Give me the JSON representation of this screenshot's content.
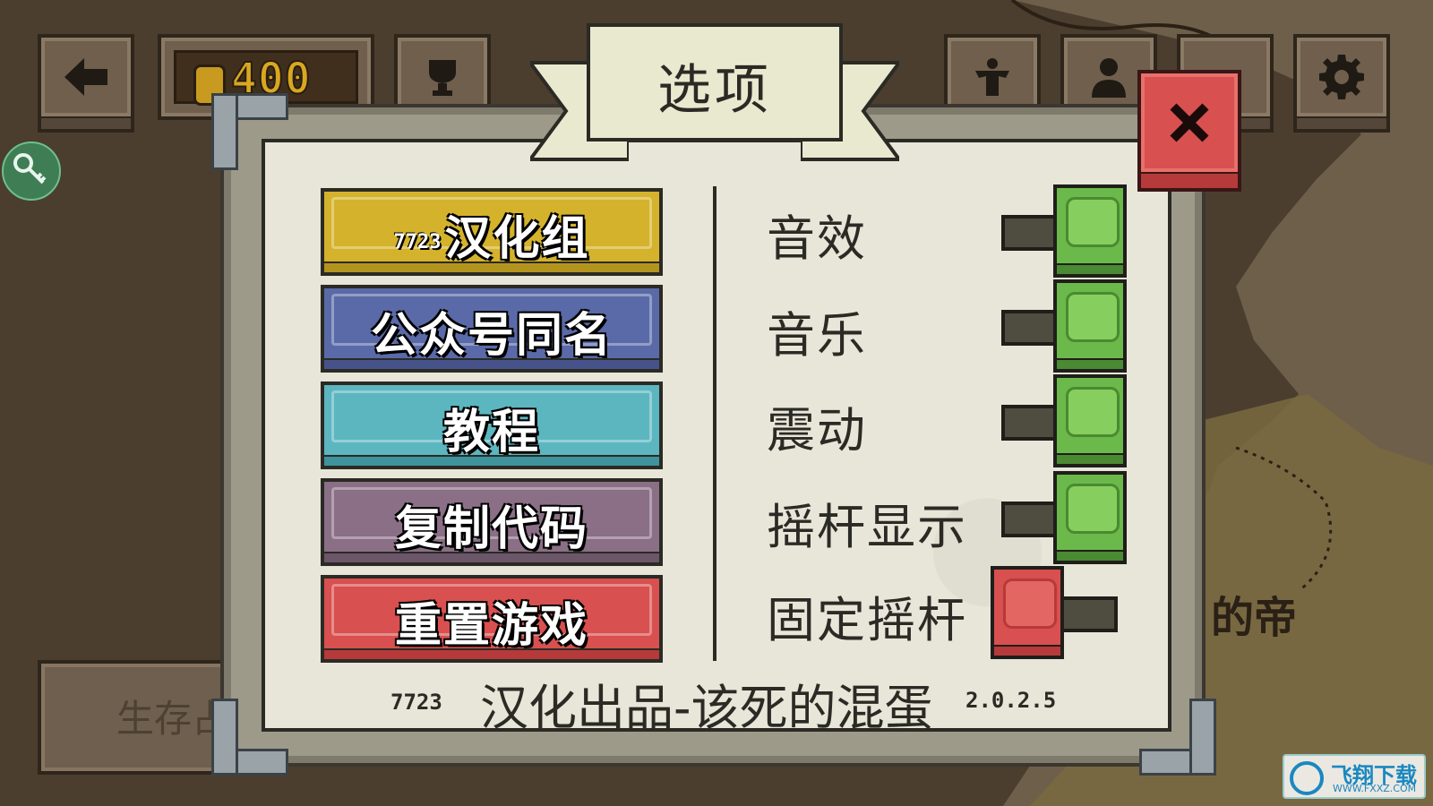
{
  "hud": {
    "coins": "400",
    "survival_label": "生存占"
  },
  "dialog": {
    "title": "选项",
    "menu": [
      {
        "badge": "7723",
        "label": "汉化组",
        "color": "#d4b22c"
      },
      {
        "label": "公众号同名",
        "color": "#5a6aa8"
      },
      {
        "label": "教程",
        "color": "#5cb6c0"
      },
      {
        "label": "复制代码",
        "color": "#8a6f86"
      },
      {
        "label": "重置游戏",
        "color": "#d8504f"
      }
    ],
    "options": [
      {
        "label": "音效",
        "state": "on"
      },
      {
        "label": "音乐",
        "state": "on"
      },
      {
        "label": "震动",
        "state": "on"
      },
      {
        "label": "摇杆显示",
        "state": "on"
      },
      {
        "label": "固定摇杆",
        "state": "off"
      }
    ],
    "footer": {
      "left": "7723",
      "main": "汉化出品-该死的混蛋",
      "version": "2.0.2.5"
    }
  },
  "map": {
    "label": "的帝"
  },
  "watermark": {
    "title": "飞翔下载",
    "url": "WWW.FXXZ.COM"
  },
  "icons": {
    "back": "arrow-left-icon",
    "trophy": "trophy-icon",
    "strength": "strongman-icon",
    "profile": "person-icon",
    "settings": "gear-icon",
    "close": "close-icon",
    "key": "key-icon",
    "coin": "coin-icon"
  }
}
